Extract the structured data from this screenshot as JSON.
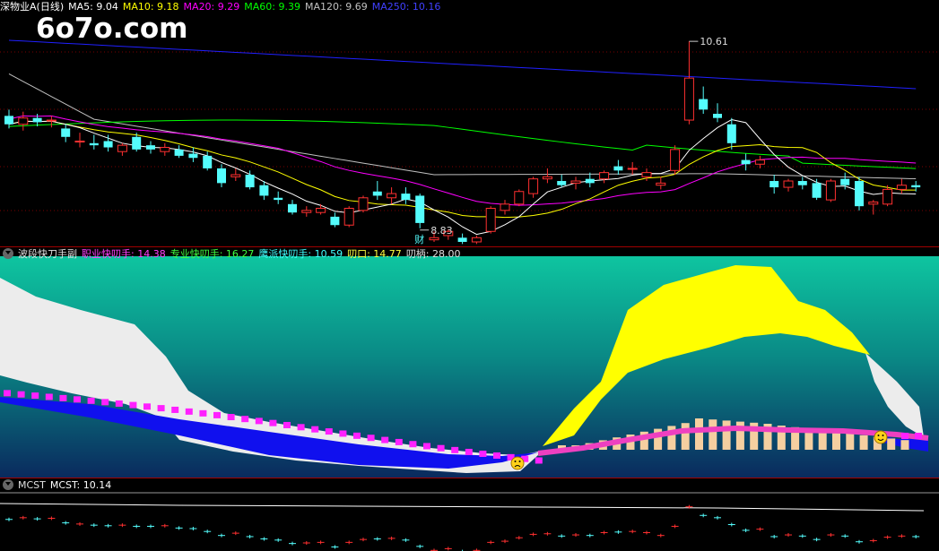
{
  "watermark": "6o7o.com",
  "colors": {
    "up": "#ff3030",
    "down": "#54fcfc",
    "ma5": "#ffffff",
    "ma10": "#ffff00",
    "ma20": "#ff00ff",
    "ma60": "#00ff00",
    "ma120": "#c0c0c0",
    "ma250": "#2020ff"
  },
  "panel1": {
    "title": "深物业A(日线)",
    "ma_labels": [
      {
        "text": "MA5: 9.04",
        "color": "#ffffff"
      },
      {
        "text": "MA10: 9.18",
        "color": "#ffff00"
      },
      {
        "text": "MA20: 9.29",
        "color": "#ff00ff"
      },
      {
        "text": "MA60: 9.39",
        "color": "#00ff00"
      },
      {
        "text": "MA120: 9.69",
        "color": "#c0c0c0"
      },
      {
        "text": "MA250: 10.16",
        "color": "#4040ff"
      }
    ],
    "high_label": "10.61",
    "low_label": "8.83",
    "fin_mark": "财"
  },
  "panel2": {
    "title": "波段快刀手副",
    "labels": [
      {
        "text": "职业快叨手: 14.38",
        "color": "#ff40ff"
      },
      {
        "text": "专业快叨手: 16.27",
        "color": "#40ff40"
      },
      {
        "text": "鹰派快叨手: 10.59",
        "color": "#40ffff"
      },
      {
        "text": "叨口: 14.77",
        "color": "#ffff40"
      },
      {
        "text": "叨柄: 28.00",
        "color": "#e0e0e0"
      }
    ]
  },
  "panel3": {
    "title": "MCST",
    "label": "MCST: 10.14"
  },
  "chart_data": [
    {
      "type": "candlestick",
      "ylim": [
        8.7,
        10.85
      ],
      "x": [
        0,
        1,
        2,
        3,
        4,
        5,
        6,
        7,
        8,
        9,
        10,
        11,
        12,
        13,
        14,
        15,
        16,
        17,
        18,
        19,
        20,
        21,
        22,
        23,
        24,
        25,
        26,
        27,
        28,
        29,
        30,
        31,
        32,
        33,
        34,
        35,
        36,
        37,
        38,
        39,
        40,
        41,
        42,
        43,
        44,
        45,
        46,
        47,
        48,
        49,
        50,
        51,
        52,
        53,
        54,
        55,
        56,
        57,
        58,
        59,
        60,
        61,
        62,
        63,
        64
      ],
      "ohlc": [
        [
          9.9,
          9.96,
          9.78,
          9.82
        ],
        [
          9.82,
          9.94,
          9.76,
          9.88
        ],
        [
          9.88,
          9.92,
          9.8,
          9.84
        ],
        [
          9.86,
          9.9,
          9.79,
          9.86
        ],
        [
          9.78,
          9.82,
          9.65,
          9.7
        ],
        [
          9.66,
          9.74,
          9.6,
          9.66
        ],
        [
          9.64,
          9.72,
          9.58,
          9.62
        ],
        [
          9.66,
          9.72,
          9.56,
          9.6
        ],
        [
          9.56,
          9.64,
          9.52,
          9.62
        ],
        [
          9.7,
          9.74,
          9.56,
          9.58
        ],
        [
          9.62,
          9.66,
          9.54,
          9.58
        ],
        [
          9.56,
          9.64,
          9.52,
          9.6
        ],
        [
          9.58,
          9.62,
          9.5,
          9.52
        ],
        [
          9.54,
          9.6,
          9.46,
          9.5
        ],
        [
          9.52,
          9.56,
          9.38,
          9.4
        ],
        [
          9.4,
          9.44,
          9.22,
          9.26
        ],
        [
          9.32,
          9.4,
          9.28,
          9.34
        ],
        [
          9.34,
          9.38,
          9.2,
          9.22
        ],
        [
          9.24,
          9.28,
          9.1,
          9.14
        ],
        [
          9.12,
          9.18,
          9.06,
          9.1
        ],
        [
          9.06,
          9.1,
          8.96,
          8.98
        ],
        [
          8.98,
          9.04,
          8.94,
          9.0
        ],
        [
          8.98,
          9.06,
          8.96,
          9.02
        ],
        [
          8.94,
          8.98,
          8.84,
          8.86
        ],
        [
          8.86,
          9.04,
          8.84,
          9.02
        ],
        [
          9.0,
          9.14,
          8.98,
          9.12
        ],
        [
          9.18,
          9.28,
          9.1,
          9.14
        ],
        [
          9.12,
          9.22,
          9.06,
          9.16
        ],
        [
          9.16,
          9.22,
          9.06,
          9.1
        ],
        [
          9.14,
          9.16,
          8.83,
          8.88
        ],
        [
          8.72,
          8.8,
          8.7,
          8.74
        ],
        [
          8.76,
          8.82,
          8.72,
          8.8
        ],
        [
          8.74,
          8.78,
          8.68,
          8.7
        ],
        [
          8.7,
          8.76,
          8.68,
          8.74
        ],
        [
          8.8,
          9.04,
          8.78,
          9.02
        ],
        [
          9.0,
          9.1,
          8.96,
          9.06
        ],
        [
          9.06,
          9.2,
          9.04,
          9.18
        ],
        [
          9.16,
          9.32,
          9.12,
          9.3
        ],
        [
          9.3,
          9.4,
          9.26,
          9.32
        ],
        [
          9.28,
          9.34,
          9.22,
          9.24
        ],
        [
          9.26,
          9.32,
          9.2,
          9.28
        ],
        [
          9.3,
          9.36,
          9.22,
          9.26
        ],
        [
          9.3,
          9.38,
          9.26,
          9.36
        ],
        [
          9.42,
          9.48,
          9.34,
          9.38
        ],
        [
          9.4,
          9.46,
          9.34,
          9.4
        ],
        [
          9.32,
          9.4,
          9.28,
          9.36
        ],
        [
          9.24,
          9.32,
          9.2,
          9.26
        ],
        [
          9.38,
          9.62,
          9.34,
          9.58
        ],
        [
          9.86,
          10.61,
          9.82,
          10.26
        ],
        [
          10.06,
          10.18,
          9.92,
          9.96
        ],
        [
          9.92,
          10.02,
          9.84,
          9.88
        ],
        [
          9.82,
          9.88,
          9.58,
          9.64
        ],
        [
          9.48,
          9.54,
          9.38,
          9.44
        ],
        [
          9.44,
          9.52,
          9.4,
          9.48
        ],
        [
          9.28,
          9.34,
          9.16,
          9.22
        ],
        [
          9.22,
          9.3,
          9.18,
          9.28
        ],
        [
          9.28,
          9.32,
          9.2,
          9.24
        ],
        [
          9.26,
          9.3,
          9.1,
          9.12
        ],
        [
          9.1,
          9.3,
          9.08,
          9.28
        ],
        [
          9.3,
          9.36,
          9.2,
          9.24
        ],
        [
          9.28,
          9.32,
          9.0,
          9.04
        ],
        [
          9.06,
          9.1,
          8.96,
          9.08
        ],
        [
          9.06,
          9.24,
          9.04,
          9.2
        ],
        [
          9.2,
          9.3,
          9.16,
          9.24
        ],
        [
          9.24,
          9.28,
          9.18,
          9.22
        ]
      ]
    },
    {
      "type": "area",
      "series_desc": "indicator bands",
      "x_count": 65
    },
    {
      "type": "line",
      "name": "MCST",
      "last": 10.14
    }
  ]
}
